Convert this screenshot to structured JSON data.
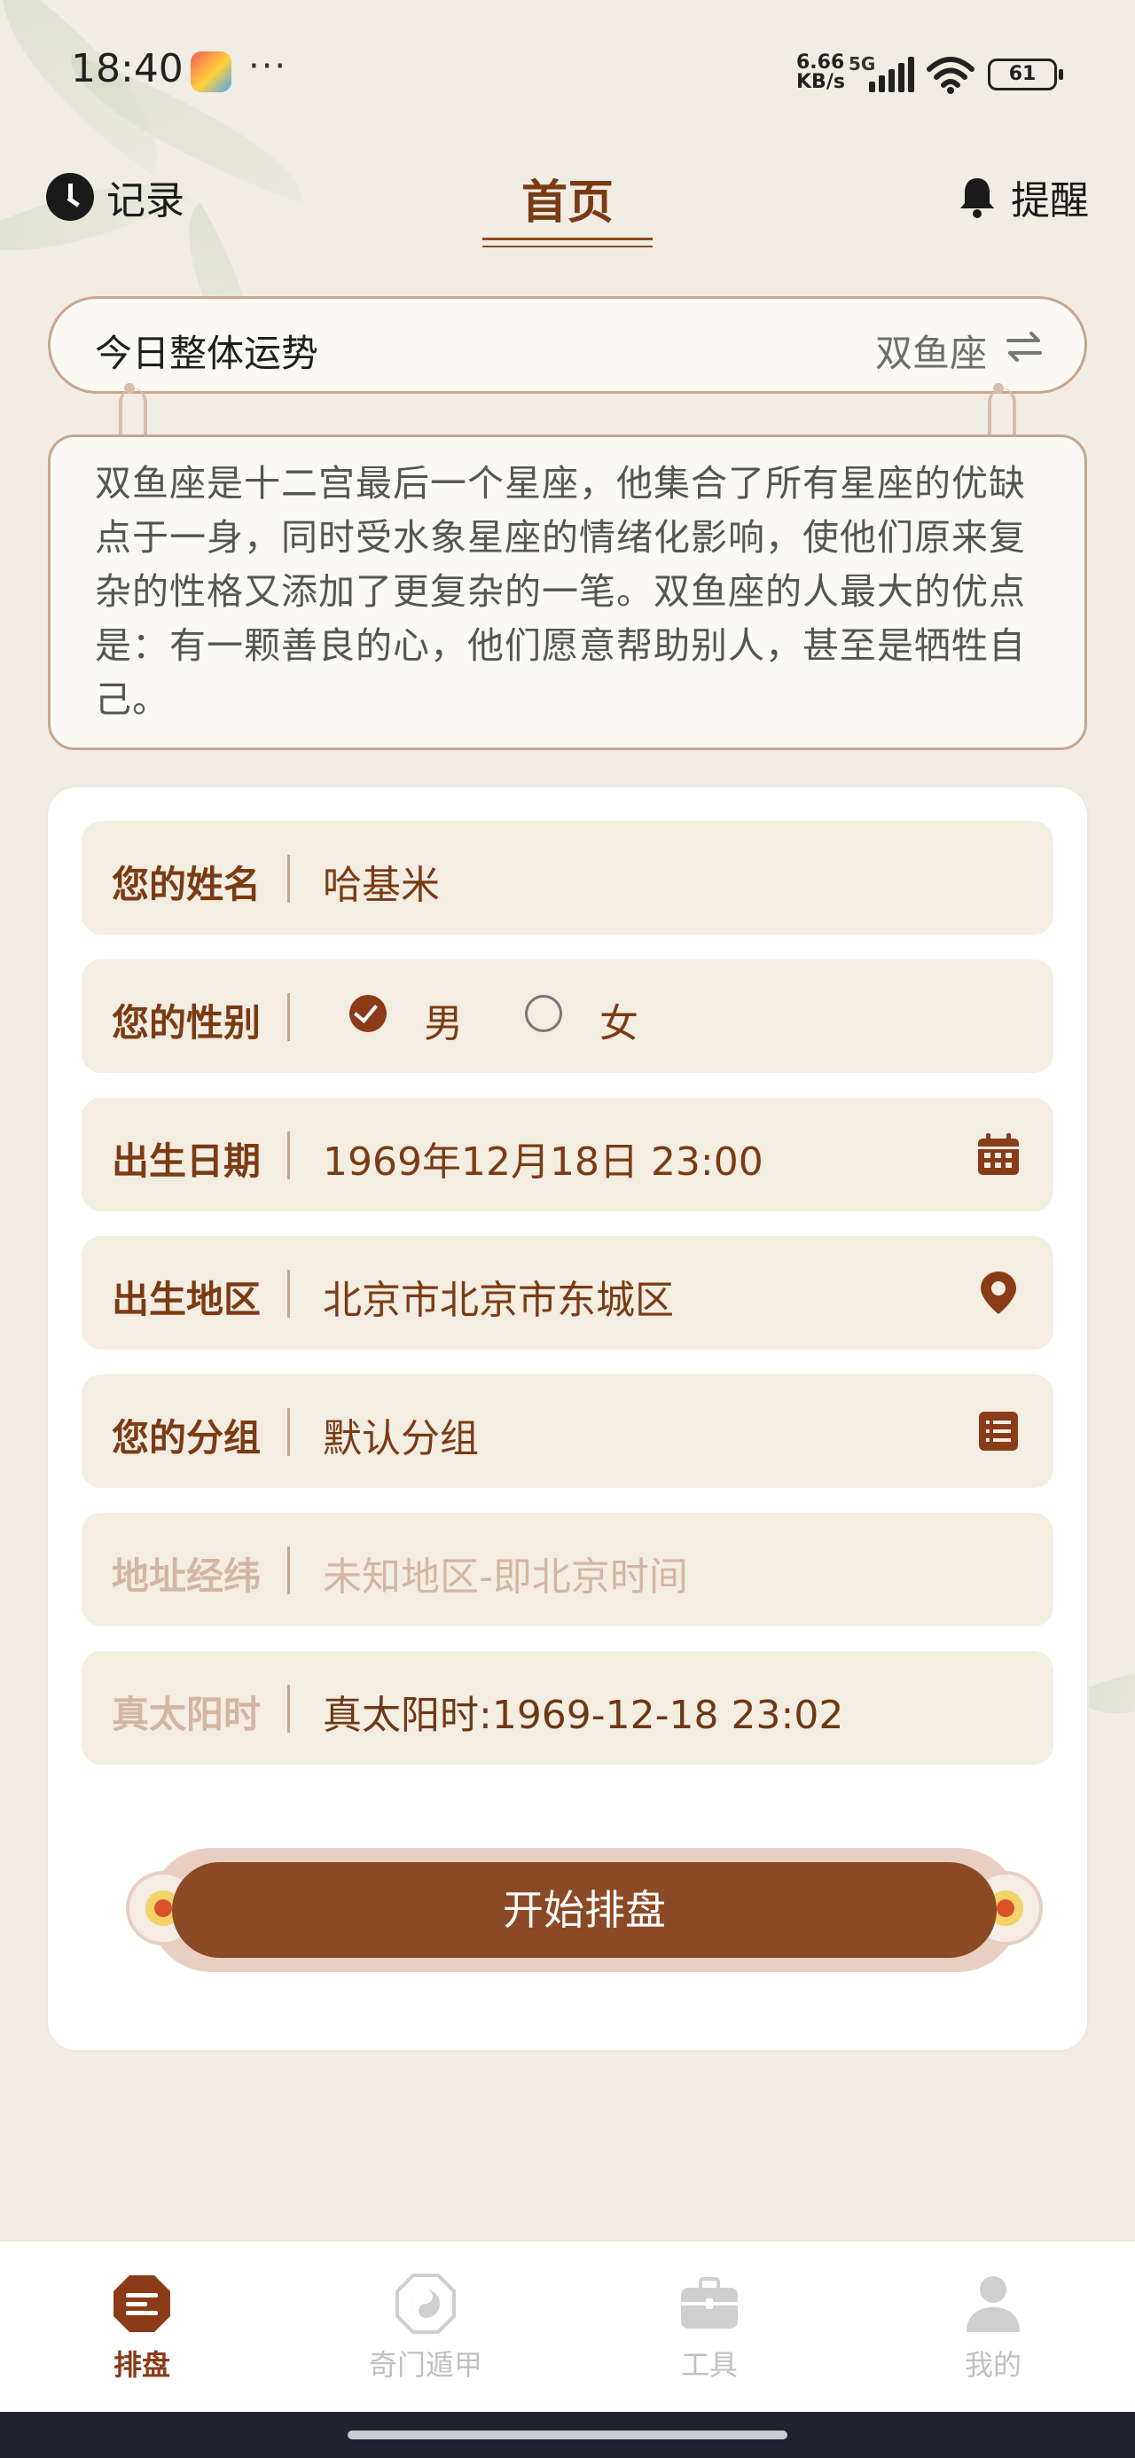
{
  "status_bar": {
    "time": "18:40",
    "more": "···",
    "net_speed_value": "6.66",
    "net_speed_unit": "KB/s",
    "network": "5G",
    "battery": "61"
  },
  "header": {
    "left_label": "记录",
    "title": "首页",
    "right_label": "提醒"
  },
  "fortune": {
    "title": "今日整体运势",
    "sign": "双鱼座",
    "description": "双鱼座是十二宫最后一个星座，他集合了所有星座的优缺点于一身，同时受水象星座的情绪化影响，使他们原来复杂的性格又添加了更复杂的一笔。双鱼座的人最大的优点是：有一颗善良的心，他们愿意帮助别人，甚至是牺牲自己。"
  },
  "form": {
    "name": {
      "label": "您的姓名",
      "value": "哈基米"
    },
    "gender": {
      "label": "您的性别",
      "male": "男",
      "female": "女",
      "selected": "男"
    },
    "birth_date": {
      "label": "出生日期",
      "value": "1969年12月18日 23:00"
    },
    "birth_place": {
      "label": "出生地区",
      "value": "北京市北京市东城区"
    },
    "group": {
      "label": "您的分组",
      "value": "默认分组"
    },
    "coords": {
      "label": "地址经纬",
      "placeholder": "未知地区-即北京时间"
    },
    "solar_time": {
      "label": "真太阳时",
      "value": "真太阳时:1969-12-18 23:02"
    },
    "submit_label": "开始排盘"
  },
  "nav": {
    "items": [
      {
        "label": "排盘",
        "icon": "paipan-icon",
        "active": true
      },
      {
        "label": "奇门遁甲",
        "icon": "bagua-icon",
        "active": false
      },
      {
        "label": "工具",
        "icon": "toolbox-icon",
        "active": false
      },
      {
        "label": "我的",
        "icon": "user-icon",
        "active": false
      }
    ]
  },
  "colors": {
    "accent": "#8a3b17",
    "background": "#f1ede4",
    "field_bg": "#f4ede2"
  }
}
